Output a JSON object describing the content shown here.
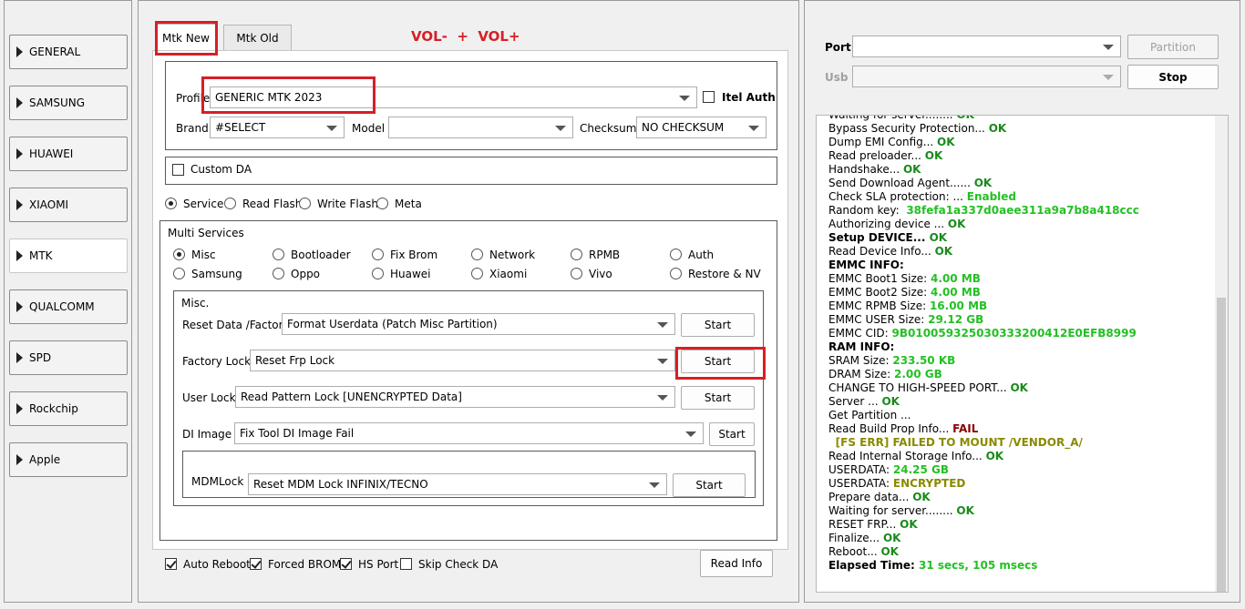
{
  "sidebar": {
    "items": [
      {
        "label": "GENERAL"
      },
      {
        "label": "SAMSUNG"
      },
      {
        "label": "HUAWEI"
      },
      {
        "label": "XIAOMI"
      },
      {
        "label": "MTK"
      },
      {
        "label": "QUALCOMM"
      },
      {
        "label": "SPD"
      },
      {
        "label": "Rockchip"
      },
      {
        "label": "Apple"
      }
    ],
    "active": "MTK"
  },
  "tabs": [
    {
      "label": "Mtk New"
    },
    {
      "label": "Mtk Old"
    }
  ],
  "vol_hint": "VOL-  +  VOL+",
  "profile": {
    "label": "Profile",
    "value": "GENERIC MTK 2023",
    "itel_auth_label": "Itel Auth"
  },
  "brand": {
    "label": "Brand",
    "value": "#SELECT"
  },
  "model": {
    "label": "Model",
    "value": ""
  },
  "checksum": {
    "label": "Checksum",
    "value": "NO CHECKSUM"
  },
  "custom_da": {
    "label": "Custom DA"
  },
  "modes": [
    {
      "label": "Service",
      "checked": true
    },
    {
      "label": "Read Flash",
      "checked": false
    },
    {
      "label": "Write Flash",
      "checked": false
    },
    {
      "label": "Meta",
      "checked": false
    }
  ],
  "multi_services": {
    "title": "Multi Services",
    "options": [
      {
        "label": "Misc",
        "checked": true
      },
      {
        "label": "Bootloader"
      },
      {
        "label": "Fix Brom"
      },
      {
        "label": "Network"
      },
      {
        "label": "RPMB"
      },
      {
        "label": "Auth"
      },
      {
        "label": "Samsung"
      },
      {
        "label": "Oppo"
      },
      {
        "label": "Huawei"
      },
      {
        "label": "Xiaomi"
      },
      {
        "label": "Vivo"
      },
      {
        "label": "Restore & NV"
      }
    ]
  },
  "misc": {
    "title": "Misc.",
    "rows": [
      {
        "label": "Reset Data /Factory",
        "value": "Format Userdata (Patch Misc Partition)",
        "button": "Start"
      },
      {
        "label": "Factory Lock",
        "value": "Reset Frp Lock",
        "button": "Start"
      },
      {
        "label": "User Lock",
        "value": "Read Pattern Lock [UNENCRYPTED Data]",
        "button": "Start"
      },
      {
        "label": "DI Image",
        "value": "Fix Tool DI Image Fail",
        "button": "Start"
      },
      {
        "label": "MDMLock",
        "value": "Reset MDM Lock INFINIX/TECNO",
        "button": "Start"
      }
    ]
  },
  "footer": {
    "auto_reboot": "Auto Reboot",
    "forced_brom": "Forced BROM",
    "hs_port": "HS Port",
    "skip_check_da": "Skip Check DA",
    "read_info": "Read Info"
  },
  "right": {
    "port_label": "Port",
    "usb_label": "Usb",
    "partition_button": "Partition",
    "stop_button": "Stop"
  },
  "log": [
    {
      "t": "Waiting for server........ ",
      "s": "OK",
      "c": "ok"
    },
    {
      "t": "Bypass Security Protection... ",
      "s": "OK",
      "c": "ok"
    },
    {
      "t": "Dump EMI Config... ",
      "s": "OK",
      "c": "ok"
    },
    {
      "t": "Read preloader... ",
      "s": "OK",
      "c": "ok"
    },
    {
      "t": "Handshake... ",
      "s": "OK",
      "c": "ok"
    },
    {
      "t": "Send Download Agent...... ",
      "s": "OK",
      "c": "ok"
    },
    {
      "t": "Check SLA protection: ... ",
      "s": "Enabled",
      "c": "val"
    },
    {
      "t": "Random key:  ",
      "s": "38fefa1a337d0aee311a9a7b8a418ccc",
      "c": "val"
    },
    {
      "t": "Authorizing device ... ",
      "s": "OK",
      "c": "ok"
    },
    {
      "t": "Setup DEVICE... ",
      "s": "OK",
      "c": "ok",
      "b": true
    },
    {
      "t": "Read Device Info... ",
      "s": "OK",
      "c": "ok"
    },
    {
      "t": "EMMC INFO:",
      "s": "",
      "c": "",
      "b": true
    },
    {
      "t": "EMMC Boot1 Size: ",
      "s": "4.00 MB",
      "c": "val"
    },
    {
      "t": "EMMC Boot2 Size: ",
      "s": "4.00 MB",
      "c": "val"
    },
    {
      "t": "EMMC RPMB Size: ",
      "s": "16.00 MB",
      "c": "val"
    },
    {
      "t": "EMMC USER Size: ",
      "s": "29.12 GB",
      "c": "val"
    },
    {
      "t": "EMMC CID: ",
      "s": "9B0100593250303332004​12E0EFB8999",
      "c": "val"
    },
    {
      "t": "RAM INFO:",
      "s": "",
      "c": "",
      "b": true
    },
    {
      "t": "SRAM Size: ",
      "s": "233.50 KB",
      "c": "val"
    },
    {
      "t": "DRAM Size: ",
      "s": "2.00 GB",
      "c": "val"
    },
    {
      "t": "CHANGE TO HIGH-SPEED PORT... ",
      "s": "OK",
      "c": "ok"
    },
    {
      "t": "Server ... ",
      "s": "OK",
      "c": "ok"
    },
    {
      "t": "Get Partition ...",
      "s": "",
      "c": ""
    },
    {
      "t": "Read Build Prop Info... ",
      "s": "FAIL",
      "c": "fail"
    },
    {
      "t": "  ",
      "s": "[FS ERR] FAILED TO MOUNT /VENDOR_A/",
      "c": "warn"
    },
    {
      "t": "Read Internal Storage Info... ",
      "s": "OK",
      "c": "ok"
    },
    {
      "t": "USERDATA: ",
      "s": "24.25 GB",
      "c": "val"
    },
    {
      "t": "USERDATA: ",
      "s": "ENCRYPTED",
      "c": "warn"
    },
    {
      "t": "Prepare data... ",
      "s": "OK",
      "c": "ok"
    },
    {
      "t": "Waiting for server........ ",
      "s": "OK",
      "c": "ok"
    },
    {
      "t": "RESET FRP... ",
      "s": "OK",
      "c": "ok"
    },
    {
      "t": "Finalize... ",
      "s": "OK",
      "c": "ok"
    },
    {
      "t": "Reboot... ",
      "s": "OK",
      "c": "ok"
    },
    {
      "t": "Elapsed Time: ",
      "s": "31 secs, 105 msecs",
      "c": "val",
      "b": true
    }
  ],
  "colors": {
    "highlight": "#d61f26",
    "vol_text": "#d61f26",
    "ok": "#1a8a1a",
    "value": "#23c023",
    "fail": "#8b0000",
    "warn": "#8a8a00"
  }
}
